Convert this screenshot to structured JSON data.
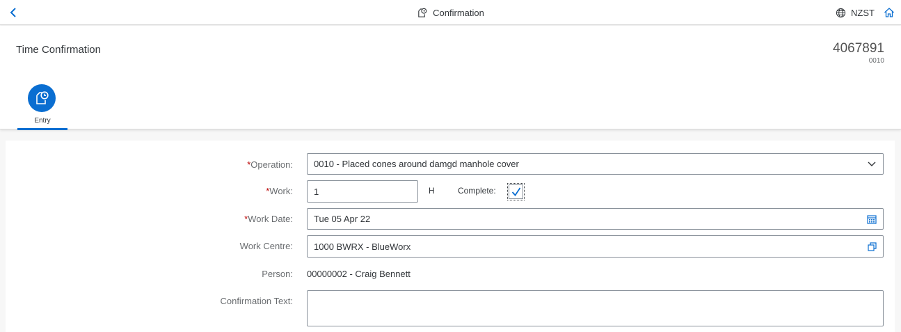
{
  "shell": {
    "title": "Confirmation",
    "timezone": "NZST",
    "icons": {
      "back": "chevron-left-icon",
      "title": "clock-document-icon",
      "timezone": "globe-icon",
      "home": "home-icon"
    }
  },
  "header": {
    "title": "Time Confirmation",
    "object_number": "4067891",
    "object_sub": "0010",
    "tabs": [
      {
        "label": "Entry",
        "icon": "clock-document-icon",
        "selected": true
      }
    ]
  },
  "form": {
    "operation": {
      "label": "Operation:",
      "required": "*",
      "value": "0010 - Placed cones around damgd manhole cover"
    },
    "work": {
      "label": "Work:",
      "required": "*",
      "value": "1",
      "unit": "H"
    },
    "complete": {
      "label": "Complete:",
      "checked": true
    },
    "work_date": {
      "label": "Work Date:",
      "required": "*",
      "value": "Tue 05 Apr 22"
    },
    "work_centre": {
      "label": "Work Centre:",
      "value": "1000 BWRX - BlueWorx"
    },
    "person": {
      "label": "Person:",
      "value": "00000002 - Craig Bennett"
    },
    "confirmation_text": {
      "label": "Confirmation Text:",
      "value": ""
    }
  },
  "colors": {
    "brand": "#0a6ed1",
    "required": "#bb0000",
    "text": "#32363a",
    "label": "#6a6d70"
  }
}
